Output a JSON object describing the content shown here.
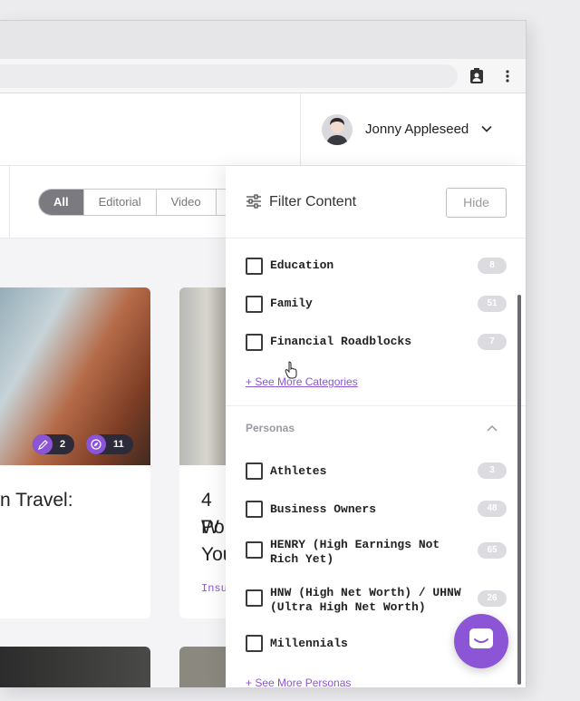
{
  "header": {
    "user_name": "Jonny Appleseed"
  },
  "filters": {
    "tabs": [
      "All",
      "Editorial",
      "Video"
    ],
    "active_tab": "All"
  },
  "cards": [
    {
      "title_fragment": "n Travel:",
      "badges": [
        {
          "icon": "pencil-icon",
          "count": "2"
        },
        {
          "icon": "compass-icon",
          "count": "11"
        }
      ]
    },
    {
      "title_lines": [
        "4 W",
        "Po",
        "You"
      ],
      "tag": "Insu"
    }
  ],
  "panel": {
    "title": "Filter Content",
    "hide_label": "Hide",
    "categories": [
      {
        "label": "Education",
        "count": "8"
      },
      {
        "label": "Family",
        "count": "51"
      },
      {
        "label": "Financial Roadblocks",
        "count": "7"
      }
    ],
    "see_more_categories": "+ See More Categories",
    "personas_header": "Personas",
    "personas": [
      {
        "label": "Athletes",
        "count": "3"
      },
      {
        "label": "Business Owners",
        "count": "48"
      },
      {
        "label": "HENRY (High Earnings Not Rich Yet)",
        "count": "65"
      },
      {
        "label": "HNW (High Net Worth) / UHNW (Ultra High Net Worth)",
        "count": "26"
      },
      {
        "label": "Millennials",
        "count": ""
      }
    ],
    "see_more_personas": "+ See More Personas"
  },
  "colors": {
    "accent": "#8b55d6",
    "badge_bg": "#dcdce0",
    "active_tab": "#7a7a80"
  }
}
